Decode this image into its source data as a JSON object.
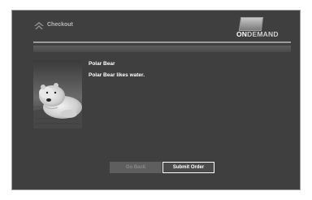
{
  "header": {
    "title": "Checkout",
    "logo": {
      "on": "ON",
      "demand": "DEMAND"
    },
    "icon": "home-arrow-icon"
  },
  "item": {
    "title": "Polar Bear",
    "description": "Polar Bear likes water.",
    "image": "polar-bear-poster"
  },
  "actions": {
    "back_label": "Go Back",
    "submit_label": "Submit Order"
  },
  "colors": {
    "background": "#3f3f3f",
    "text": "#ffffff",
    "muted": "#b8b8b8"
  }
}
